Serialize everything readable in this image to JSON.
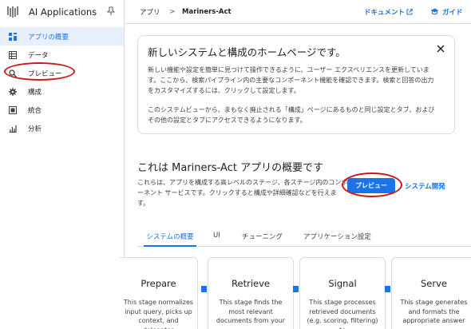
{
  "app": {
    "title": "AI Applications"
  },
  "sidebar": {
    "items": [
      {
        "label": "アプリの概要",
        "icon": "dashboard-icon",
        "active": true
      },
      {
        "label": "データ",
        "icon": "database-icon",
        "active": false
      },
      {
        "label": "プレビュー",
        "icon": "search-icon",
        "active": false
      },
      {
        "label": "構成",
        "icon": "gear-icon",
        "active": false
      },
      {
        "label": "統合",
        "icon": "integration-icon",
        "active": false
      },
      {
        "label": "分析",
        "icon": "analytics-icon",
        "active": false
      }
    ]
  },
  "topbar": {
    "breadcrumb": [
      "アプリ",
      "Mariners-Act"
    ],
    "separator": ">",
    "doc_link": "ドキュメント",
    "guide_link": "ガイド"
  },
  "banner": {
    "title": "新しいシステムと構成のホームページです。",
    "paragraph1": "新しい機能や設定を簡単に見つけて操作できるように、ユーザー エクスペリエンスを更新しています。ここから、検索パイプライン内の主要なコンポーネント機能を確認できます。検索と回答の出力をカスタマイズするには、クリックして設定します。",
    "paragraph2": "このシステムビューから、まもなく廃止される「構成」ページにあるものと同じ設定とタブ、およびその他の設定とタブにアクセスできるようになります。"
  },
  "main": {
    "title": "これは Mariners-Act アプリの概要です",
    "description": "これらは、アプリを構成する高レベルのステージ、各ステージ内のコンポーネント サービスです。クリックすると構成や詳細確認などを行えます。",
    "preview_button": "プレビュー",
    "system_dev_link": "システム開発"
  },
  "tabs": [
    {
      "label": "システムの概要",
      "active": true
    },
    {
      "label": "UI",
      "active": false
    },
    {
      "label": "チューニング",
      "active": false
    },
    {
      "label": "アプリケーション設定",
      "active": false
    }
  ],
  "cards": [
    {
      "title": "Prepare",
      "desc": "This stage normalizes input query, picks up context, and delegates"
    },
    {
      "title": "Retrieve",
      "desc": "This stage finds the most relevant documents from your"
    },
    {
      "title": "Signal",
      "desc": "This stage processes retrieved documents (e.g. scoring, filtering) to"
    },
    {
      "title": "Serve",
      "desc": "This stage generates and formats the appropriate answer"
    }
  ],
  "colors": {
    "accent": "#1a73e8",
    "annotation": "#d01818",
    "active_bg": "#e8f0fe"
  }
}
